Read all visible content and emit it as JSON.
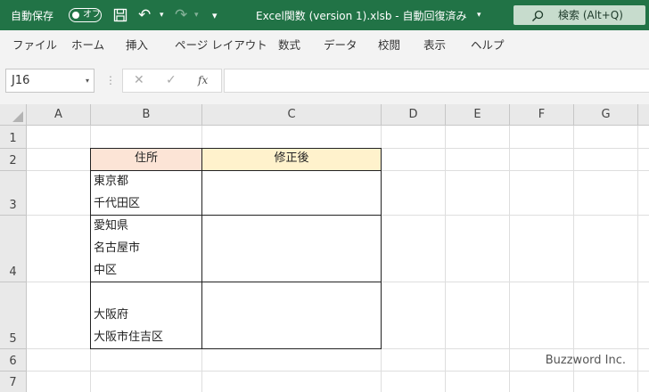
{
  "titlebar": {
    "autosave_label": "自動保存",
    "autosave_state": "オフ",
    "undo_icon": "↶",
    "redo_icon": "↷",
    "dropdown_glyph": "▾",
    "qat_more_glyph": "▾",
    "title": "Excel関数 (version 1).xlsb  -  自動回復済み",
    "title_chevron": "▾",
    "search_text": "検索 (Alt+Q)",
    "accent": "#217346"
  },
  "ribbon_tabs": [
    "ファイル",
    "ホーム",
    "挿入",
    "ページ レイアウト",
    "数式",
    "データ",
    "校閲",
    "表示",
    "ヘルプ"
  ],
  "formula_bar": {
    "name_box": "J16",
    "name_box_dd": "▾",
    "dots": "⋮",
    "cancel_glyph": "✕",
    "enter_glyph": "✓",
    "fx_label": "fx",
    "formula": ""
  },
  "columns": [
    "A",
    "B",
    "C",
    "D",
    "E",
    "F",
    "G"
  ],
  "rows": [
    "1",
    "2",
    "3",
    "4",
    "5",
    "6",
    "7"
  ],
  "table": {
    "header_b": "住所",
    "header_c": "修正後",
    "header_b_color": "#fce4d6",
    "header_c_color": "#fff2cc",
    "row3": [
      "東京都",
      "千代田区"
    ],
    "row4": [
      "愛知県",
      "名古屋市",
      "中区"
    ],
    "row5": [
      "大阪府",
      "大阪市住吉区"
    ]
  },
  "watermark": "Buzzword Inc."
}
